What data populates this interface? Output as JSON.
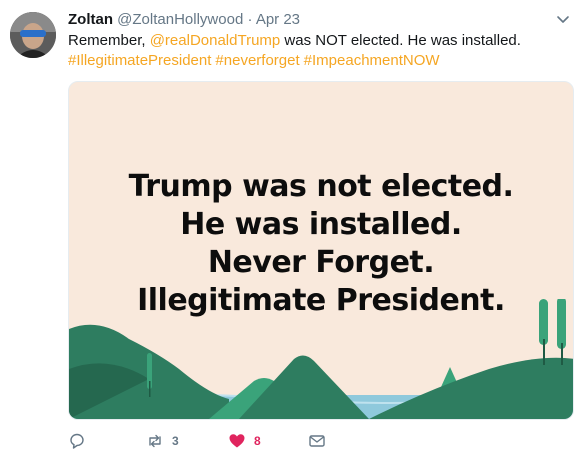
{
  "tweet": {
    "author_name": "Zoltan",
    "author_handle": "@ZoltanHollywood",
    "separator": "·",
    "date": "Apr 23",
    "text_before": "Remember, ",
    "mention": "@realDonaldTrump",
    "text_after": " was NOT elected. He was installed.",
    "hashtags": [
      "#IllegitimatePresident",
      "#neverforget",
      "#ImpeachmentNOW"
    ]
  },
  "media": {
    "lines": [
      "Trump was not elected.",
      "He was installed.",
      "Never Forget.",
      "Illegitimate President."
    ]
  },
  "actions": {
    "reply_count": "",
    "retweet_count": "3",
    "like_count": "8"
  },
  "colors": {
    "link": "#f5a623",
    "like": "#e0245e",
    "muted": "#657786",
    "media_bg": "#f9e9dc"
  },
  "icons": [
    "chevron-down-icon",
    "reply-icon",
    "retweet-icon",
    "heart-icon",
    "message-icon"
  ]
}
